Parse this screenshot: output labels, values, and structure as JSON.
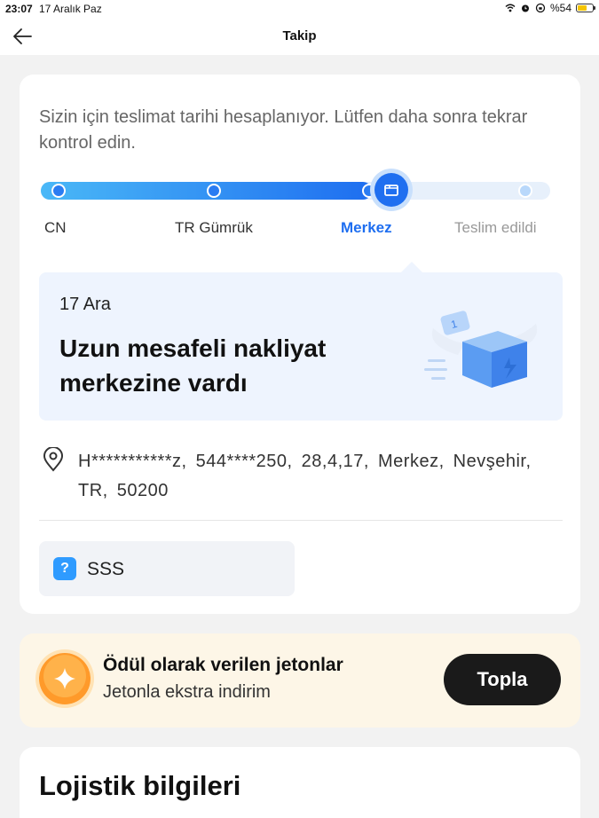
{
  "status_bar": {
    "time": "23:07",
    "date": "17 Aralık Paz",
    "battery_text": "%54",
    "battery_level": 0.54
  },
  "navbar": {
    "title": "Takip",
    "back_icon": "arrow-left-icon"
  },
  "tracking": {
    "estimate_text": "Sizin için teslimat tarihi hesaplanıyor. Lütfen daha sonra tekrar kontrol edin.",
    "progress_fraction": 0.65,
    "stages": [
      {
        "label": "CN",
        "state": "done"
      },
      {
        "label": "TR Gümrük",
        "state": "done"
      },
      {
        "label": "Merkez",
        "state": "current"
      },
      {
        "label": "Teslim edildi",
        "state": "future"
      }
    ],
    "colors": {
      "active": "#1e6ef0",
      "track": "#e7f0fb",
      "gradient_start": "#4ab8f7"
    }
  },
  "event": {
    "date": "17 Ara",
    "title": "Uzun mesafeli nakliyat merkezine vardı",
    "illustration": "flying-package-icon"
  },
  "address": {
    "icon": "location-pin-icon",
    "text": "H***********z, 544****250, 28,4,17, Merkez, Nevşehir, TR, 50200"
  },
  "faq": {
    "icon": "question-icon",
    "label": "SSS"
  },
  "coins": {
    "icon": "coin-star-icon",
    "title": "Ödül olarak verilen jetonlar",
    "subtitle": "Jetonla ekstra indirim",
    "button_label": "Topla"
  },
  "logistics": {
    "title": "Lojistik bilgileri"
  }
}
